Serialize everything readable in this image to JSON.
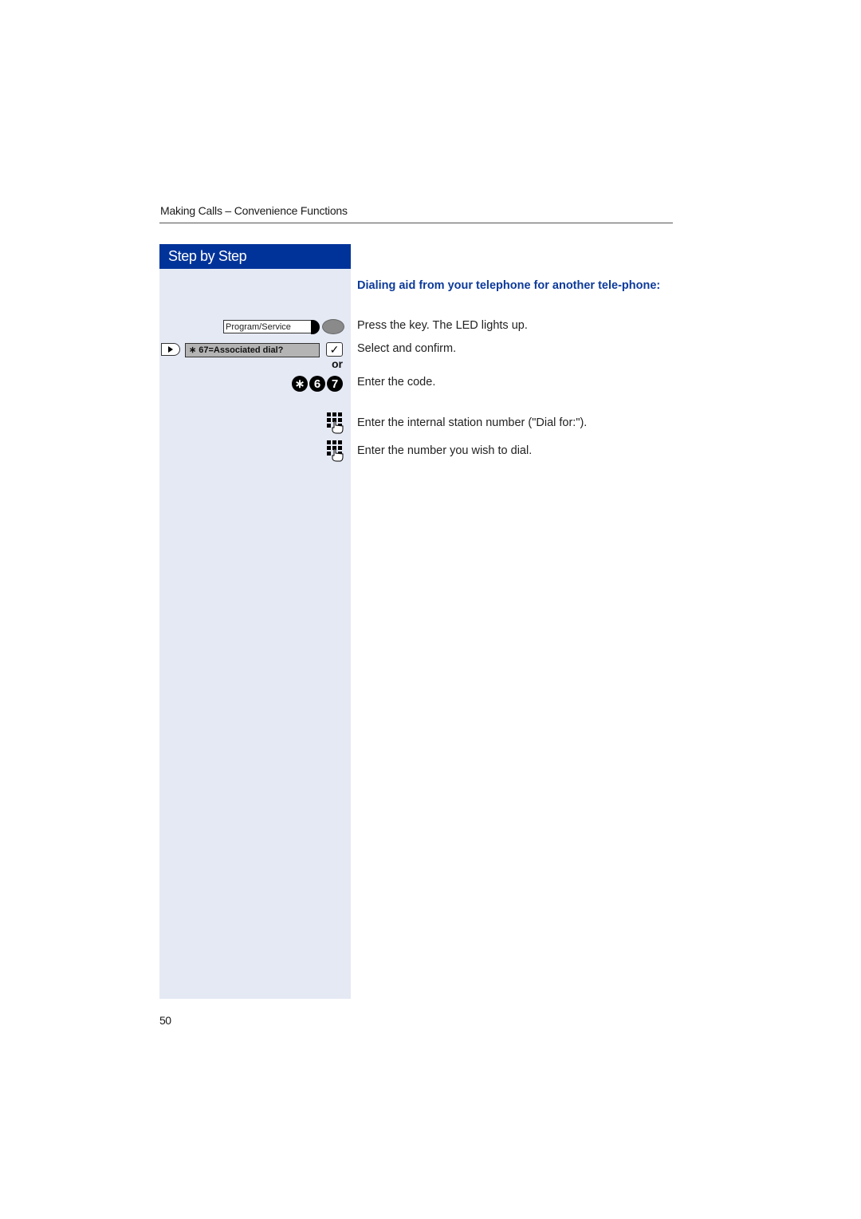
{
  "header": {
    "title": "Making Calls – Convenience Functions"
  },
  "sidebar": {
    "title": "Step by Step",
    "program_key_label": "Program/Service",
    "menu_entry": "∗ 67=Associated dial?",
    "confirm_symbol": "✓",
    "or_label": "or",
    "code_keys": [
      "∗",
      "6",
      "7"
    ]
  },
  "content": {
    "heading": "Dialing aid from your telephone for another tele-phone:",
    "steps": [
      "Press the key. The LED lights up.",
      "Select and confirm.",
      "Enter the code.",
      "Enter the internal station number (\"Dial for:\").",
      "Enter the number you wish to dial."
    ]
  },
  "footer": {
    "page_number": "50"
  },
  "colors": {
    "accent_blue": "#003399",
    "sidebar_bg": "#e4e9f4",
    "heading_blue": "#0d3a9a"
  }
}
